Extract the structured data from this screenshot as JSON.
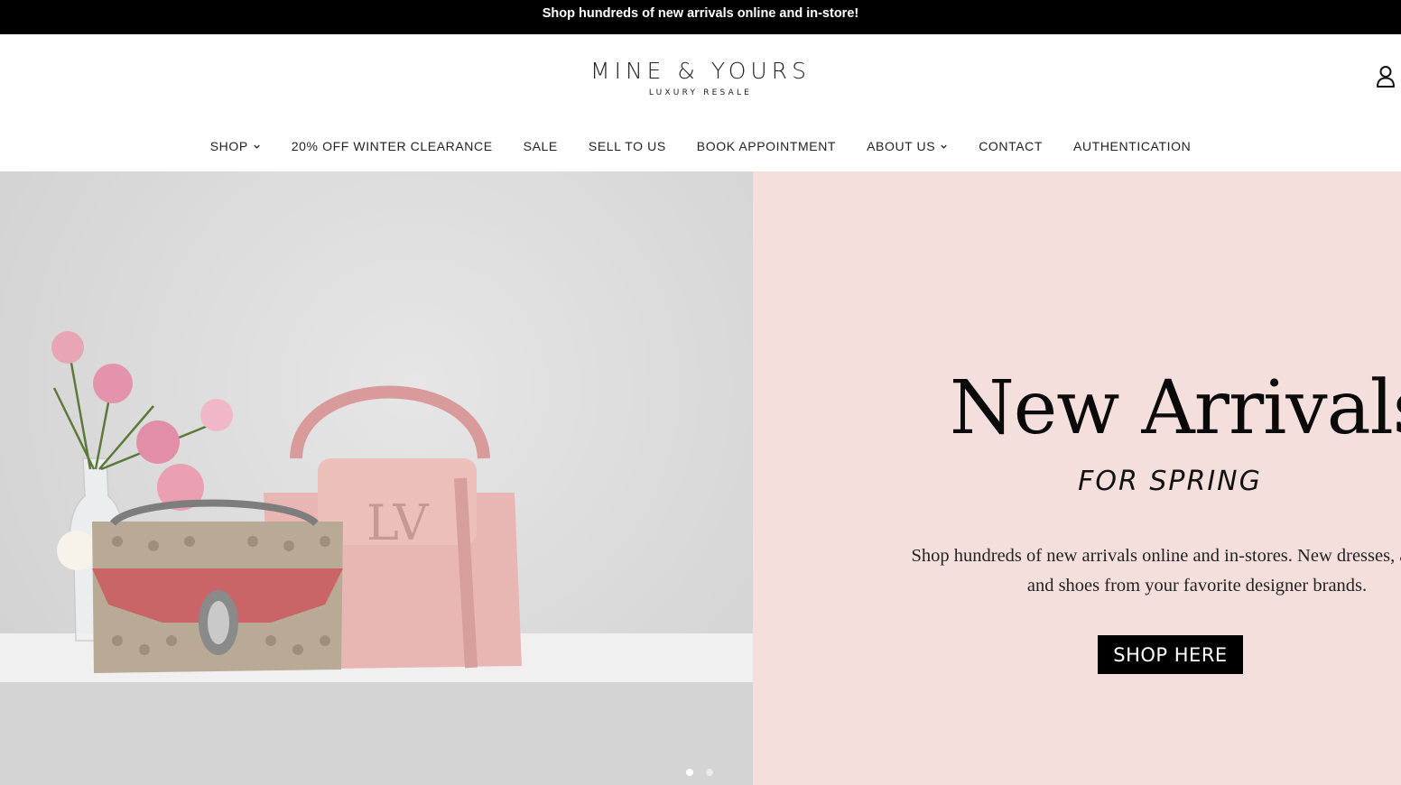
{
  "announcement": "Shop hundreds of new arrivals online and in-store!",
  "logo": {
    "main": "MINE & YOURS",
    "sub": "LUXURY RESALE"
  },
  "nav": [
    {
      "label": "SHOP",
      "dropdown": true
    },
    {
      "label": "20% OFF WINTER CLEARANCE",
      "dropdown": false
    },
    {
      "label": "SALE",
      "dropdown": false
    },
    {
      "label": "SELL TO US",
      "dropdown": false
    },
    {
      "label": "BOOK APPOINTMENT",
      "dropdown": false
    },
    {
      "label": "ABOUT US",
      "dropdown": true
    },
    {
      "label": "CONTACT",
      "dropdown": false
    },
    {
      "label": "AUTHENTICATION",
      "dropdown": false
    }
  ],
  "hero": {
    "headline": "New Arrivals",
    "subhead": "FOR SPRING",
    "body": "Shop hundreds of new arrivals online and in-stores. New dresses, accessories and shoes from your favorite designer brands.",
    "cta": "SHOP HERE",
    "background_color": "#f5dfdc",
    "slides_total": 2,
    "slide_active": 1
  },
  "icons": {
    "account": "user-icon",
    "chevron": "chevron-down-icon"
  }
}
